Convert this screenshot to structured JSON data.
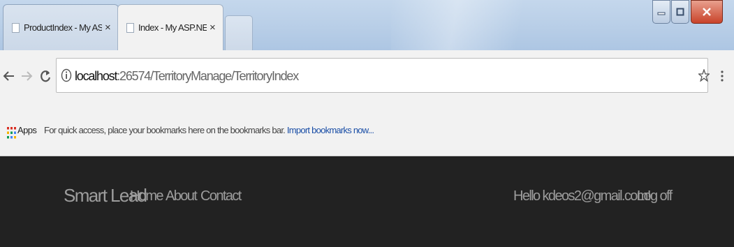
{
  "browser": {
    "tabs": [
      {
        "title": "ProductIndex - My ASP.",
        "close": "×",
        "active": false
      },
      {
        "title": "Index - My ASP.NET App",
        "close": "×",
        "active": true
      }
    ],
    "address": {
      "host": "localhost",
      "path": ":26574/TerritoryManage/TerritoryIndex"
    },
    "bookmarks_bar": {
      "apps_label": "Apps",
      "hint_text": "For quick access, place your bookmarks here on the bookmarks bar.",
      "import_link": "Import bookmarks now..."
    },
    "icons": {
      "back": "back-arrow-icon",
      "forward": "forward-arrow-icon",
      "reload": "reload-icon",
      "info": "info-icon",
      "bookmark": "star-icon",
      "menu": "menu-dots-icon",
      "apps": "apps-grid-icon"
    }
  },
  "site": {
    "brand": "Smart Lead",
    "nav": [
      "Home",
      "About",
      "Contact"
    ],
    "greeting": "Hello kdeos2@gmail.com!",
    "logoff": "Log off"
  },
  "colors": {
    "navbar_bg": "#222222",
    "navbar_text": "#9d9d9d",
    "link_blue": "#1a4ea6",
    "titlebar_blue": "#b8cee7",
    "close_red": "#c9432a"
  }
}
